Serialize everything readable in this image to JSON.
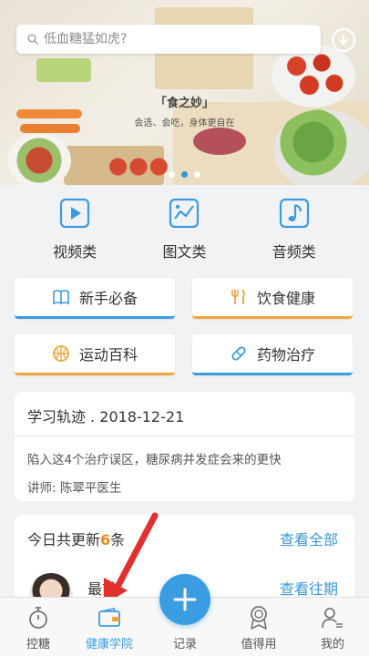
{
  "search": {
    "placeholder": "低血糖猛如虎?"
  },
  "banner": {
    "title": "「食之妙」",
    "subtitle": "会选、会吃，身体更自在",
    "dots": 3,
    "active_dot": 1
  },
  "categories": [
    {
      "label": "视频类",
      "icon": "video-play-icon"
    },
    {
      "label": "图文类",
      "icon": "image-chart-icon"
    },
    {
      "label": "音频类",
      "icon": "music-note-icon"
    }
  ],
  "grid": [
    {
      "label": "新手必备",
      "icon": "book-icon",
      "accent": "#3a9ce1"
    },
    {
      "label": "饮食健康",
      "icon": "fork-knife-icon",
      "accent": "#f0a53a"
    },
    {
      "label": "运动百科",
      "icon": "ball-icon",
      "accent": "#f0a53a"
    },
    {
      "label": "药物治疗",
      "icon": "pill-icon",
      "accent": "#3a9ce1"
    }
  ],
  "study": {
    "title": "学习轨迹 . 2018-12-21",
    "article": "陷入这4个治疗误区，糖尿病并发症会来的更快",
    "teacher": "讲师: 陈翠平医生"
  },
  "updates": {
    "prefix": "今日共更新",
    "count": "6",
    "suffix": "条",
    "view_all": "查看全部",
    "recent_label": "最前",
    "view_past": "查看往期"
  },
  "nav": [
    {
      "label": "控糖",
      "icon": "timer-icon",
      "active": false
    },
    {
      "label": "健康学院",
      "icon": "wallet-icon",
      "active": true
    },
    {
      "label": "记录",
      "icon": "plus-icon",
      "active": false
    },
    {
      "label": "值得用",
      "icon": "medal-icon",
      "active": false
    },
    {
      "label": "我的",
      "icon": "user-icon",
      "active": false
    }
  ],
  "colors": {
    "accent": "#3a9ce1",
    "orange": "#f0a53a",
    "count": "#f08a1d",
    "annotation_arrow": "#e0312f"
  }
}
